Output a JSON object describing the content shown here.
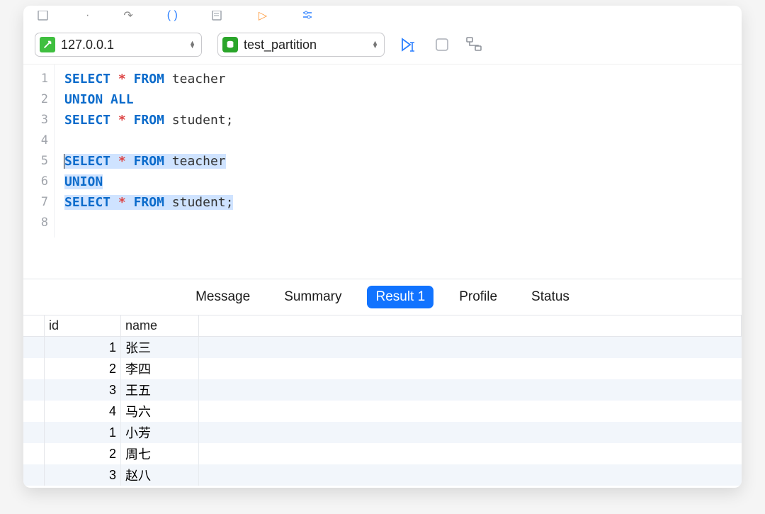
{
  "connections": {
    "host": "127.0.0.1",
    "database": "test_partition"
  },
  "editor": {
    "lines": [
      {
        "n": 1,
        "tokens": [
          {
            "t": "SELECT",
            "c": "kw"
          },
          {
            "t": " "
          },
          {
            "t": "*",
            "c": "op"
          },
          {
            "t": " "
          },
          {
            "t": "FROM",
            "c": "kw"
          },
          {
            "t": " "
          },
          {
            "t": "teacher",
            "c": "pn"
          }
        ]
      },
      {
        "n": 2,
        "tokens": [
          {
            "t": "UNION ALL",
            "c": "kw"
          }
        ]
      },
      {
        "n": 3,
        "tokens": [
          {
            "t": "SELECT",
            "c": "kw"
          },
          {
            "t": " "
          },
          {
            "t": "*",
            "c": "op"
          },
          {
            "t": " "
          },
          {
            "t": "FROM",
            "c": "kw"
          },
          {
            "t": " "
          },
          {
            "t": "student",
            "c": "pn"
          },
          {
            "t": ";",
            "c": "pn"
          }
        ]
      },
      {
        "n": 4,
        "tokens": []
      },
      {
        "n": 5,
        "hl": true,
        "caret": true,
        "tokens": [
          {
            "t": "SELECT",
            "c": "kw"
          },
          {
            "t": " "
          },
          {
            "t": "*",
            "c": "op"
          },
          {
            "t": " "
          },
          {
            "t": "FROM",
            "c": "kw"
          },
          {
            "t": " "
          },
          {
            "t": "teacher",
            "c": "pn"
          }
        ]
      },
      {
        "n": 6,
        "hl": true,
        "tokens": [
          {
            "t": "UNION",
            "c": "kw"
          }
        ]
      },
      {
        "n": 7,
        "hl": true,
        "tokens": [
          {
            "t": "SELECT",
            "c": "kw"
          },
          {
            "t": " "
          },
          {
            "t": "*",
            "c": "op"
          },
          {
            "t": " "
          },
          {
            "t": "FROM",
            "c": "kw"
          },
          {
            "t": " "
          },
          {
            "t": "student",
            "c": "pn"
          },
          {
            "t": ";",
            "c": "pn"
          }
        ]
      },
      {
        "n": 8,
        "tokens": []
      }
    ]
  },
  "tabs": {
    "items": [
      "Message",
      "Summary",
      "Result 1",
      "Profile",
      "Status"
    ],
    "active": "Result 1"
  },
  "result": {
    "columns": [
      "id",
      "name"
    ],
    "rows": [
      {
        "id": "1",
        "name": "张三"
      },
      {
        "id": "2",
        "name": "李四"
      },
      {
        "id": "3",
        "name": "王五"
      },
      {
        "id": "4",
        "name": "马六"
      },
      {
        "id": "1",
        "name": "小芳"
      },
      {
        "id": "2",
        "name": "周七"
      },
      {
        "id": "3",
        "name": "赵八"
      }
    ]
  }
}
